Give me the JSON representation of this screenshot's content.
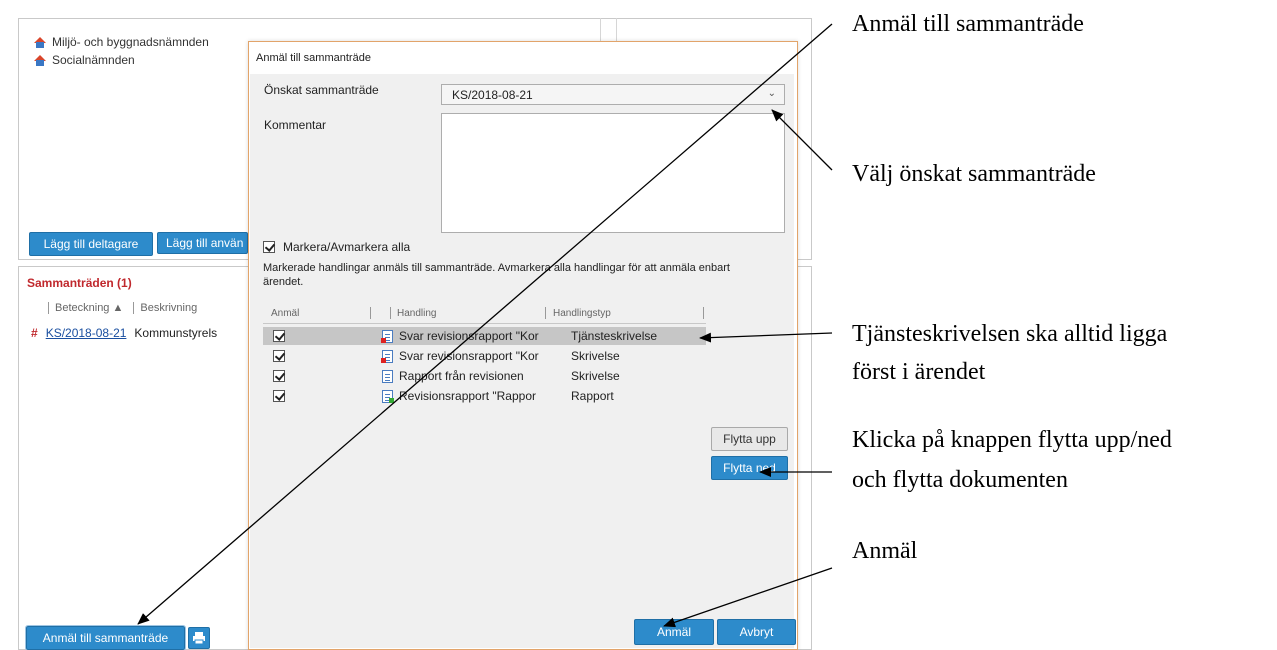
{
  "background": {
    "organizations": [
      "Miljö- och byggnadsnämnden",
      "Socialnämnden"
    ],
    "add_participant_label": "Lägg till deltagare",
    "add_user_label": "Lägg till använ",
    "meetings_title": "Sammanträden (1)",
    "table_headers": [
      "Beteckning ▲",
      "Beskrivning"
    ],
    "meeting_row": {
      "id": "KS/2018-08-21",
      "description": "Kommunstyrels"
    },
    "register_label": "Anmäl till sammanträde"
  },
  "dialog": {
    "title": "Anmäl till sammanträde",
    "desired_meeting_label": "Önskat sammanträde",
    "desired_meeting_value": "KS/2018-08-21",
    "comment_label": "Kommentar",
    "select_all_label": "Markera/Avmarkera alla",
    "info_text": "Markerade handlingar anmäls till sammanträde. Avmarkera alla handlingar för att anmäla enbart ärendet.",
    "columns": [
      "Anmäl",
      "Handling",
      "Handlingstyp"
    ],
    "documents": [
      {
        "name": "Svar revisionsrapport \"Kor",
        "type": "Tjänsteskrivelse",
        "icon": "document-red-icon"
      },
      {
        "name": "Svar revisionsrapport \"Kor",
        "type": "Skrivelse",
        "icon": "document-red-icon"
      },
      {
        "name": "Rapport från revisionen",
        "type": "Skrivelse",
        "icon": "document-icon"
      },
      {
        "name": "Revisionsrapport \"Rappor",
        "type": "Rapport",
        "icon": "document-green-icon"
      }
    ],
    "move_up_label": "Flytta upp",
    "move_down_label": "Flytta ned",
    "submit_label": "Anmäl",
    "cancel_label": "Avbryt"
  },
  "annotations": {
    "a1": "Anmäl till sammanträde",
    "a2": "Välj önskat sammanträde",
    "a3_line1": "Tjänsteskrivelsen ska alltid ligga",
    "a3_line2": "först i ärendet",
    "a4_line1": "Klicka på knappen flytta upp/ned",
    "a4_line2": "och flytta dokumenten",
    "a5": "Anmäl"
  },
  "colors": {
    "accent_blue": "#2d8bcb",
    "section_red": "#c0282d",
    "dialog_border": "#e2a46a"
  }
}
